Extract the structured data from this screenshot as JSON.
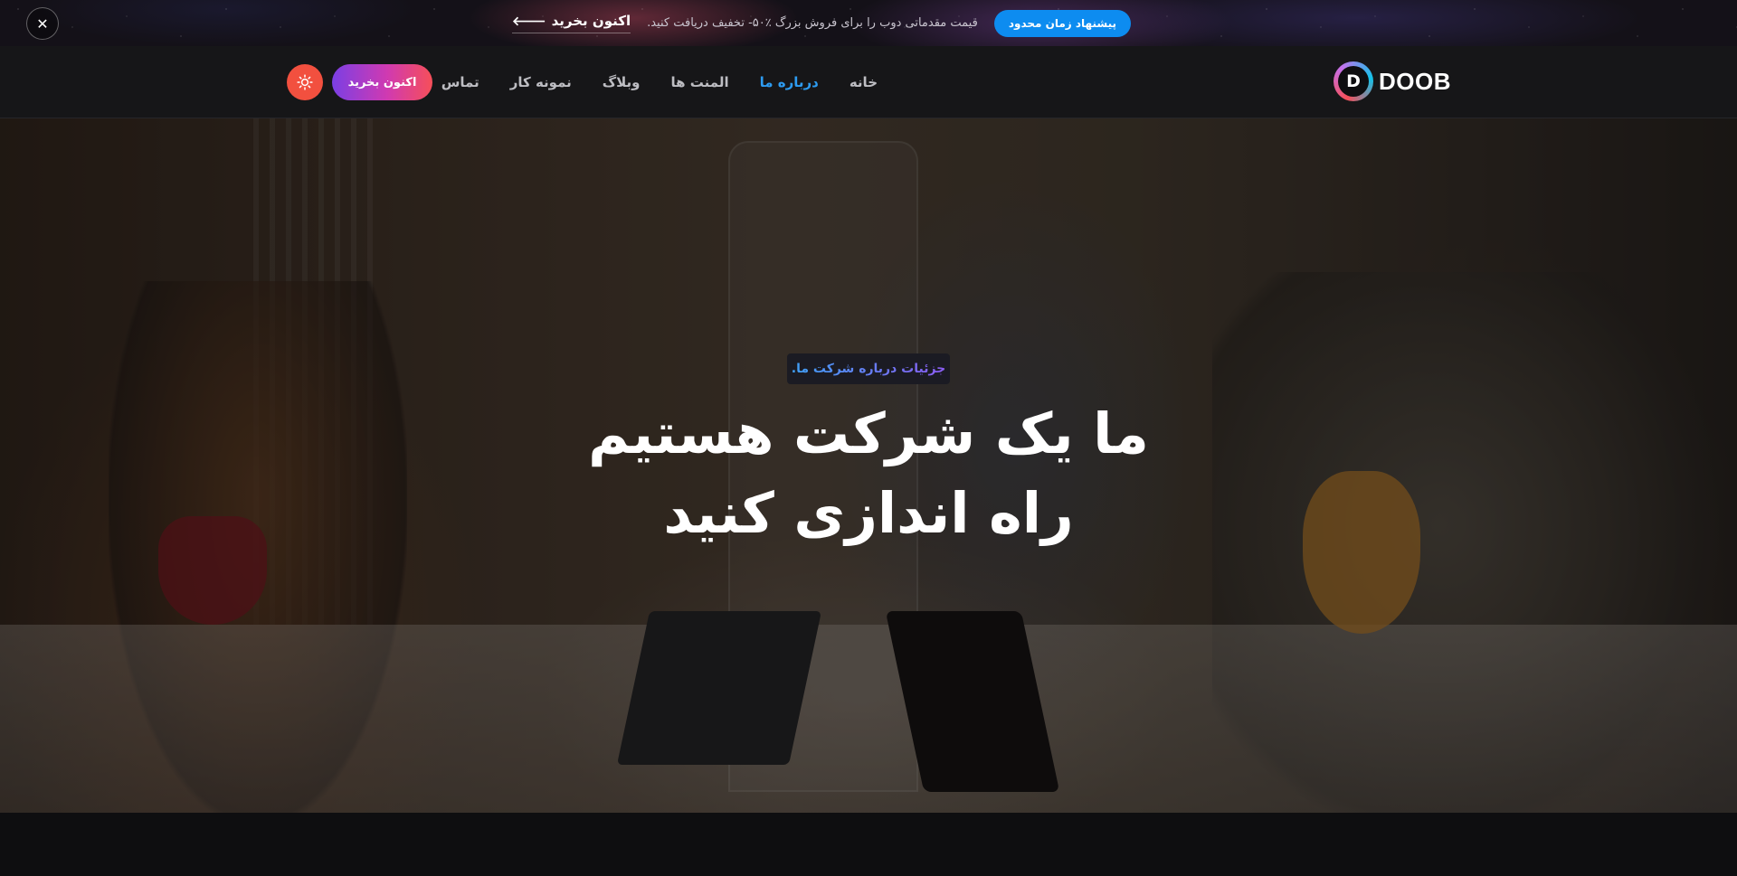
{
  "promo": {
    "badge": "پیشنهاد زمان محدود",
    "text": "قیمت مقدماتی دوب را برای فروش بزرگ ٪۵۰- تخفیف دریافت کنید.",
    "link": "اکنون بخرید",
    "link_arrow": "🡐",
    "close": "✕"
  },
  "header": {
    "logo_letter": "D",
    "logo_text": "DOOB",
    "nav": [
      {
        "label": "خانه",
        "active": false
      },
      {
        "label": "درباره ما",
        "active": true
      },
      {
        "label": "المنت ها",
        "active": false
      },
      {
        "label": "وبلاگ",
        "active": false
      },
      {
        "label": "نمونه کار",
        "active": false
      },
      {
        "label": "تماس",
        "active": false
      }
    ],
    "buy_button": "اکنون بخرید",
    "theme_icon": "☀"
  },
  "hero": {
    "tag": "جزئیات درباره شرکت ما.",
    "title_line1": "ما یک شرکت هستیم",
    "title_line2": "راه اندازی کنید"
  },
  "colors": {
    "accent_blue": "#2d9bf0",
    "promo_badge": "#0d8cf0",
    "buy_gradient_start": "#7b3fe4",
    "buy_gradient_end": "#f64f59",
    "theme_button": "#f2503f"
  }
}
